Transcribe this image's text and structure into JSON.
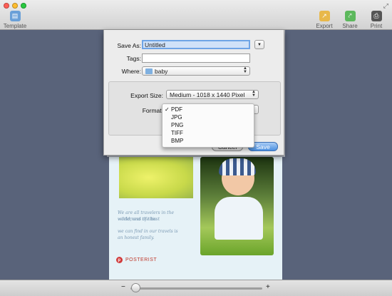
{
  "toolbar": {
    "template_label": "Template",
    "export_label": "Export",
    "share_label": "Share",
    "print_label": "Print"
  },
  "save_sheet": {
    "save_as_label": "Save As:",
    "save_as_value": "Untitled",
    "tags_label": "Tags:",
    "tags_value": "",
    "where_label": "Where:",
    "where_value": "baby",
    "export_size_label": "Export Size:",
    "export_size_value": "Medium - 1018 x 1440 Pixel",
    "format_label": "Format:",
    "cancel_label": "Cancel",
    "save_label": "Save"
  },
  "format_menu": {
    "selected": "PDF",
    "items": [
      "PDF",
      "JPG",
      "PNG",
      "TIFF",
      "BMP"
    ]
  },
  "poster": {
    "line1": "We are all travelers in the wilderness of this",
    "line2": "world, and the best",
    "line3": "we can find in our travels is",
    "line4": "an honest family.",
    "logo_text": "POSTERIST"
  },
  "zoom": {
    "minus": "−",
    "plus": "+",
    "level": 0.0
  },
  "colors": {
    "export": "#e8b84a",
    "share": "#5cb85c",
    "print": "#555555",
    "template": "#6aa0d8"
  }
}
